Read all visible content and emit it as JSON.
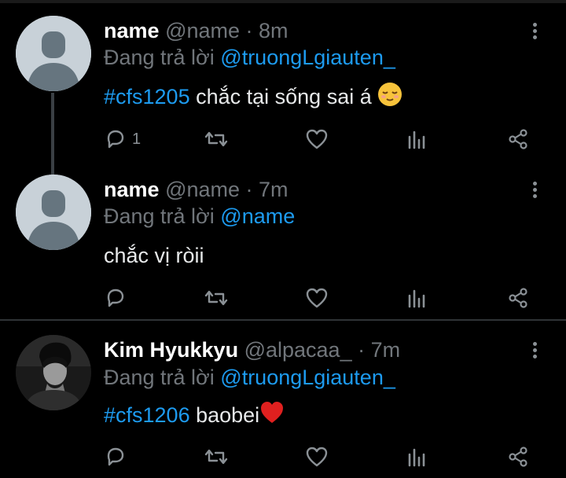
{
  "tweets": [
    {
      "name": "name",
      "handle": "@name",
      "time": "· 8m",
      "reply_prefix": "Đang trả lời",
      "reply_to": "@truongLgiauten_",
      "hashtag": "#cfs1205",
      "text": " chắc tại sống sai á",
      "emoji": "relieved-face",
      "reply_count": "1"
    },
    {
      "name": "name",
      "handle": "@name",
      "time": "· 7m",
      "reply_prefix": "Đang trả lời",
      "reply_to": "@name",
      "hashtag": "",
      "text": "chắc vị ròii",
      "reply_count": ""
    },
    {
      "name": "Kim Hyukkyu",
      "handle": "@alpacaa_",
      "time": "· 7m",
      "reply_prefix": "Đang trả lời",
      "reply_to": "@truongLgiauten_",
      "hashtag": "#cfs1206",
      "text": " baobei",
      "emoji": "red-heart",
      "reply_count": ""
    }
  ],
  "colors": {
    "accent": "#1d9bf0",
    "muted": "#71767b",
    "background": "#000000"
  },
  "action_icons": [
    "reply-icon",
    "retweet-icon",
    "like-icon",
    "views-icon",
    "share-icon"
  ]
}
